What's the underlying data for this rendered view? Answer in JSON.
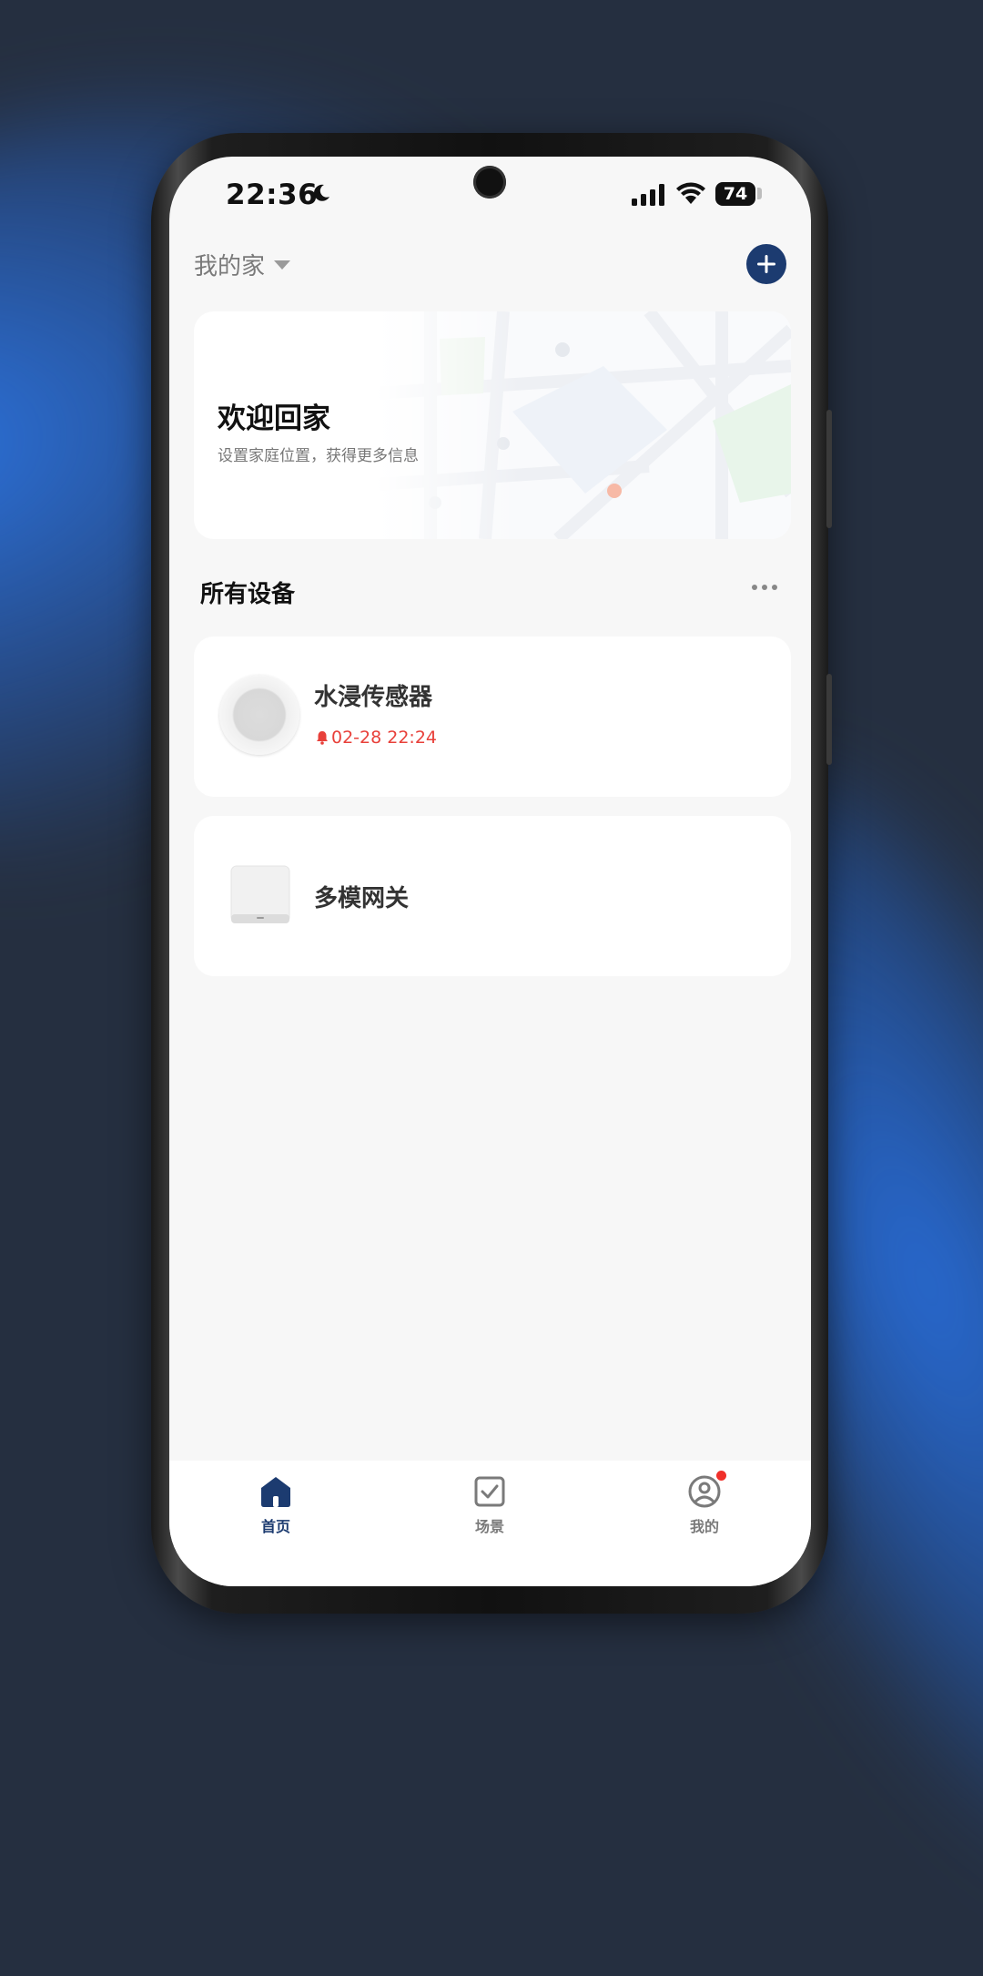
{
  "status_bar": {
    "time": "22:36",
    "battery": "74"
  },
  "header": {
    "home_name": "我的家",
    "add_icon": "plus-icon"
  },
  "welcome_card": {
    "title": "欢迎回家",
    "subtitle": "设置家庭位置，获得更多信息"
  },
  "devices_section": {
    "title": "所有设备",
    "more_icon": "more-dots-icon"
  },
  "devices": [
    {
      "name": "水浸传感器",
      "alert_time": "02-28 22:24",
      "icon": "water-sensor-icon",
      "alert_icon": "bell-icon"
    },
    {
      "name": "多模网关",
      "icon": "gateway-icon"
    }
  ],
  "bottom_nav": [
    {
      "label": "首页",
      "icon": "home-icon",
      "active": true
    },
    {
      "label": "场景",
      "icon": "scene-check-icon",
      "active": false
    },
    {
      "label": "我的",
      "icon": "profile-icon",
      "active": false,
      "badge": true
    }
  ],
  "colors": {
    "accent": "#1c3b70",
    "alert": "#e8403a",
    "screen_bg": "#f7f7f7"
  }
}
